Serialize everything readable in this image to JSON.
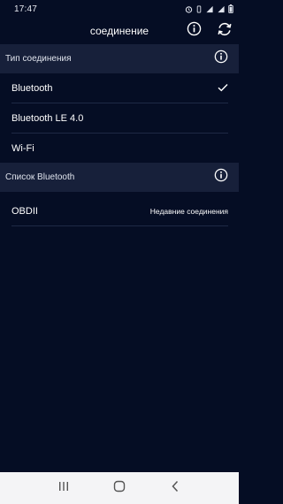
{
  "status_bar": {
    "time": "17:47",
    "icons": [
      "alarm-icon",
      "vibrate-icon",
      "signal-icon",
      "signal-icon",
      "battery-icon"
    ]
  },
  "app_bar": {
    "title": "соединение",
    "info_icon": "info-icon",
    "refresh_icon": "refresh-icon"
  },
  "connection_type": {
    "header": "Тип соединения",
    "items": [
      {
        "label": "Bluetooth",
        "selected": true
      },
      {
        "label": "Bluetooth LE 4.0",
        "selected": false
      },
      {
        "label": "Wi-Fi",
        "selected": false
      }
    ]
  },
  "bluetooth_list": {
    "header": "Список Bluetooth",
    "devices": [
      {
        "name": "OBDII",
        "status": "Недавние соединения"
      }
    ]
  },
  "nav": {
    "icons": [
      "recent-apps-icon",
      "home-icon",
      "back-icon"
    ]
  },
  "colors": {
    "background": "#050d24",
    "section_header": "#17203a",
    "nav_bar": "#f4f4f6"
  }
}
